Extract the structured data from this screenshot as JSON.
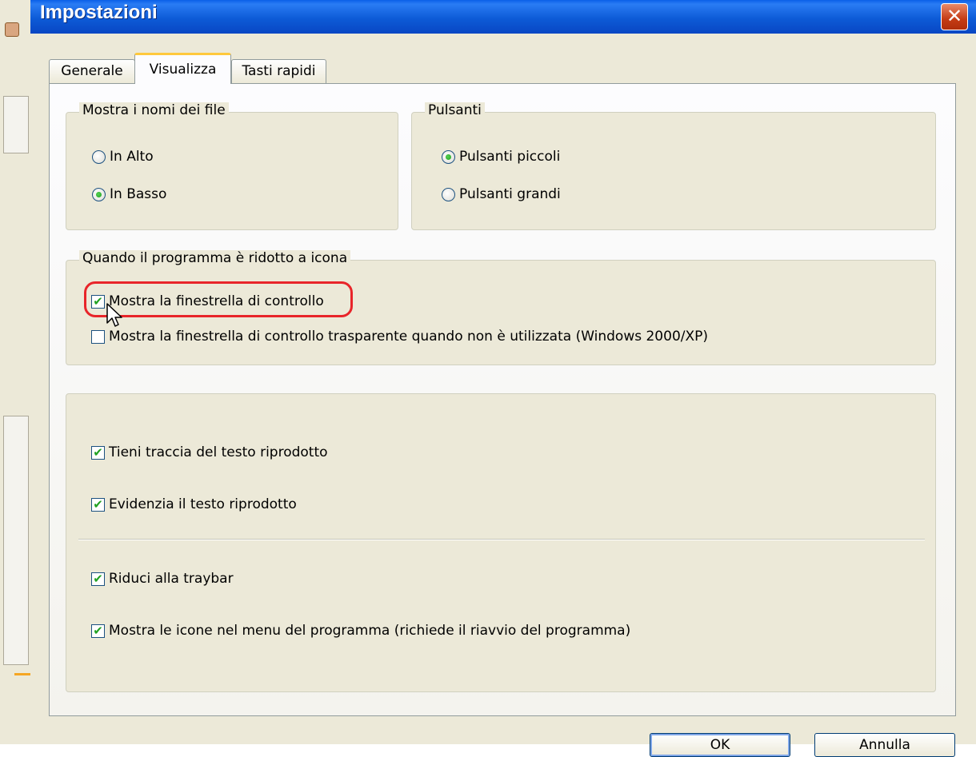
{
  "dialog": {
    "title": "Impostazioni",
    "close_label": "✕"
  },
  "tabs": [
    {
      "label": "Generale",
      "active": false
    },
    {
      "label": "Visualizza",
      "active": true
    },
    {
      "label": "Tasti rapidi",
      "active": false
    }
  ],
  "file_names_group": {
    "legend": "Mostra i nomi dei file",
    "options": [
      {
        "label": "In Alto",
        "selected": false
      },
      {
        "label": "In Basso",
        "selected": true
      }
    ]
  },
  "buttons_group": {
    "legend": "Pulsanti",
    "options": [
      {
        "label": "Pulsanti piccoli",
        "selected": true
      },
      {
        "label": "Pulsanti grandi",
        "selected": false
      }
    ]
  },
  "minimized_group": {
    "legend": "Quando il programma è ridotto a icona",
    "options": [
      {
        "label": "Mostra la finestrella di controllo",
        "checked": true
      },
      {
        "label": "Mostra la finestrella di controllo trasparente quando non è utilizzata (Windows 2000/XP)",
        "checked": false
      }
    ]
  },
  "options_group": {
    "options": [
      {
        "label": "Tieni traccia del testo riprodotto",
        "checked": true
      },
      {
        "label": "Evidenzia il testo riprodotto",
        "checked": true
      },
      {
        "label": "Riduci alla traybar",
        "checked": true
      },
      {
        "label": "Mostra le icone nel menu del programma (richiede il riavvio del programma)",
        "checked": true
      }
    ]
  },
  "footer": {
    "ok_label": "OK",
    "cancel_label": "Annulla"
  },
  "colors": {
    "titlebar": "#0d5bd7",
    "highlight_ring": "#e8252a",
    "check_mark": "#21a121"
  },
  "icons": {
    "check": "✔",
    "cursor": "mouse-pointer-icon"
  }
}
